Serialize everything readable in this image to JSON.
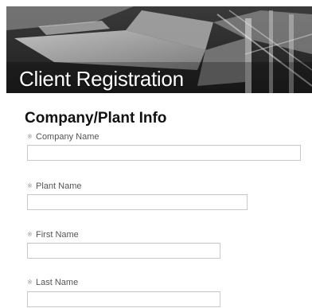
{
  "banner": {
    "title": "Client Registration"
  },
  "section": {
    "title": "Company/Plant Info"
  },
  "required_marker": "※",
  "fields": [
    {
      "label": "Company Name",
      "value": ""
    },
    {
      "label": "Plant Name",
      "value": ""
    },
    {
      "label": "First Name",
      "value": ""
    },
    {
      "label": "Last Name",
      "value": ""
    }
  ]
}
